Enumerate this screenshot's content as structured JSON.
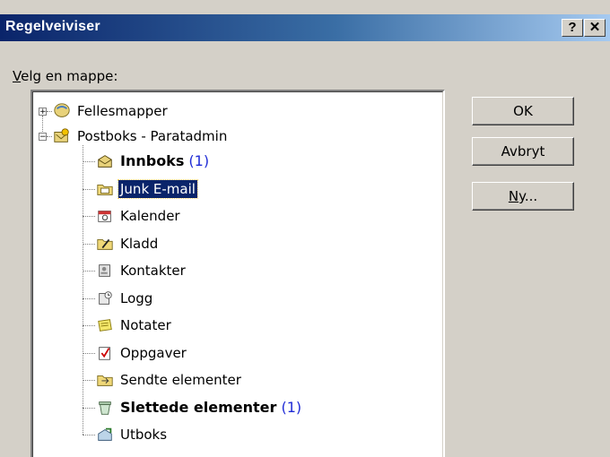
{
  "window": {
    "title": "Regelveiviser",
    "help_glyph": "?",
    "close_glyph": "✕"
  },
  "folder_label": "Velg en mappe:",
  "folder_label_accel": "V",
  "folder_label_rest": "elg en mappe:",
  "tree": {
    "roots": [
      {
        "label": "Fellesmapper",
        "expander": "+",
        "icon": "public-folders-icon"
      },
      {
        "label": "Postboks - Paratadmin",
        "expander": "−",
        "icon": "mailbox-icon"
      }
    ],
    "children": [
      {
        "label": "Innboks",
        "count": "(1)",
        "bold": true,
        "selected": false,
        "icon": "inbox-icon"
      },
      {
        "label": "Junk E-mail",
        "count": "",
        "bold": false,
        "selected": true,
        "icon": "junk-folder-icon"
      },
      {
        "label": "Kalender",
        "count": "",
        "bold": false,
        "selected": false,
        "icon": "calendar-icon"
      },
      {
        "label": "Kladd",
        "count": "",
        "bold": false,
        "selected": false,
        "icon": "drafts-icon"
      },
      {
        "label": "Kontakter",
        "count": "",
        "bold": false,
        "selected": false,
        "icon": "contacts-icon"
      },
      {
        "label": "Logg",
        "count": "",
        "bold": false,
        "selected": false,
        "icon": "journal-icon"
      },
      {
        "label": "Notater",
        "count": "",
        "bold": false,
        "selected": false,
        "icon": "notes-icon"
      },
      {
        "label": "Oppgaver",
        "count": "",
        "bold": false,
        "selected": false,
        "icon": "tasks-icon"
      },
      {
        "label": "Sendte elementer",
        "count": "",
        "bold": false,
        "selected": false,
        "icon": "sent-items-icon"
      },
      {
        "label": "Slettede elementer",
        "count": "(1)",
        "bold": true,
        "selected": false,
        "icon": "deleted-items-icon"
      },
      {
        "label": "Utboks",
        "count": "",
        "bold": false,
        "selected": false,
        "icon": "outbox-icon"
      }
    ]
  },
  "buttons": {
    "ok": "OK",
    "cancel": "Avbryt",
    "new_accel": "N",
    "new_rest": "y..."
  },
  "colors": {
    "title_start": "#0a246a",
    "selection": "#0a246a",
    "count": "#1f2bd6",
    "face": "#d4d0c8"
  }
}
